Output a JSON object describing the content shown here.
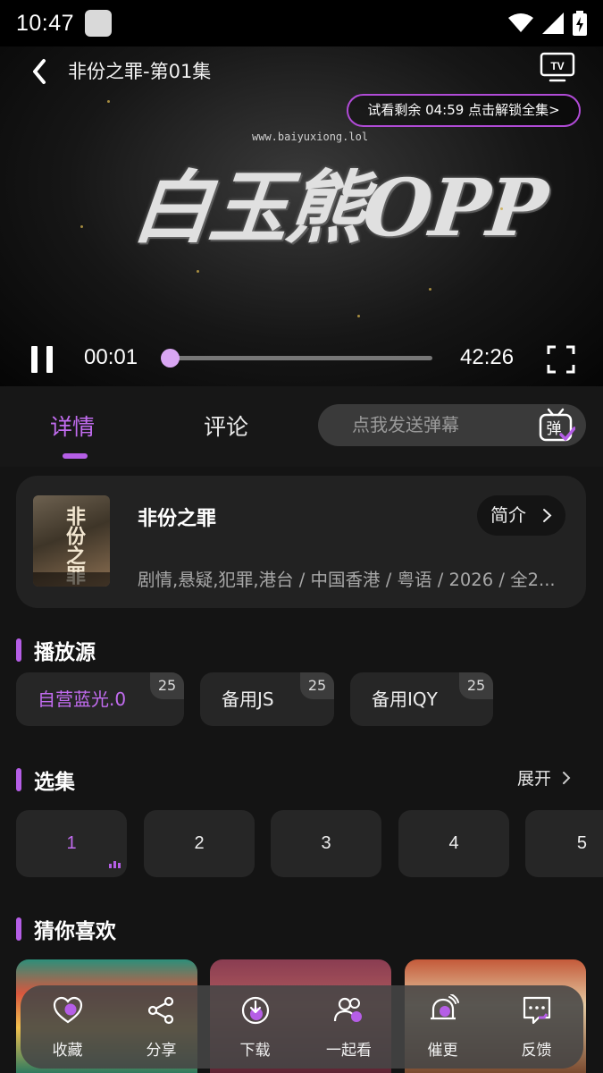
{
  "status_bar": {
    "time": "10:47"
  },
  "player": {
    "title": "非份之罪-第01集",
    "trial_text": "试看剩余 04:59  点击解锁全集>",
    "watermark": "www.baiyuxiong.lol",
    "logo_text": "白玉熊OPP",
    "current_time": "00:01",
    "total_time": "42:26",
    "progress": 0.0004
  },
  "tabs": [
    {
      "label": "详情",
      "active": true
    },
    {
      "label": "评论",
      "active": false
    }
  ],
  "danmaku": {
    "placeholder": "点我发送弹幕",
    "icon_label": "弹"
  },
  "show": {
    "title": "非份之罪",
    "intro_label": "简介",
    "meta": "剧情,悬疑,犯罪,港台 / 中国香港 / 粤语 / 2026 / 全2...",
    "poster_text": "非份之罪"
  },
  "sections": {
    "sources_title": "播放源",
    "episodes_title": "选集",
    "expand_label": "展开",
    "recommend_title": "猜你喜欢"
  },
  "sources": [
    {
      "label": "自营蓝光.0",
      "count": "25",
      "active": true
    },
    {
      "label": "备用JS",
      "count": "25",
      "active": false
    },
    {
      "label": "备用IQY",
      "count": "25",
      "active": false
    }
  ],
  "episodes": [
    "1",
    "2",
    "3",
    "4",
    "5"
  ],
  "actions": [
    {
      "label": "收藏",
      "icon": "heart-icon"
    },
    {
      "label": "分享",
      "icon": "share-icon"
    },
    {
      "label": "下载",
      "icon": "download-icon"
    },
    {
      "label": "一起看",
      "icon": "watch-together-icon"
    },
    {
      "label": "催更",
      "icon": "bell-icon"
    },
    {
      "label": "反馈",
      "icon": "feedback-icon"
    }
  ],
  "colors": {
    "accent": "#b55ee6",
    "background": "#141414",
    "card": "#222222"
  }
}
